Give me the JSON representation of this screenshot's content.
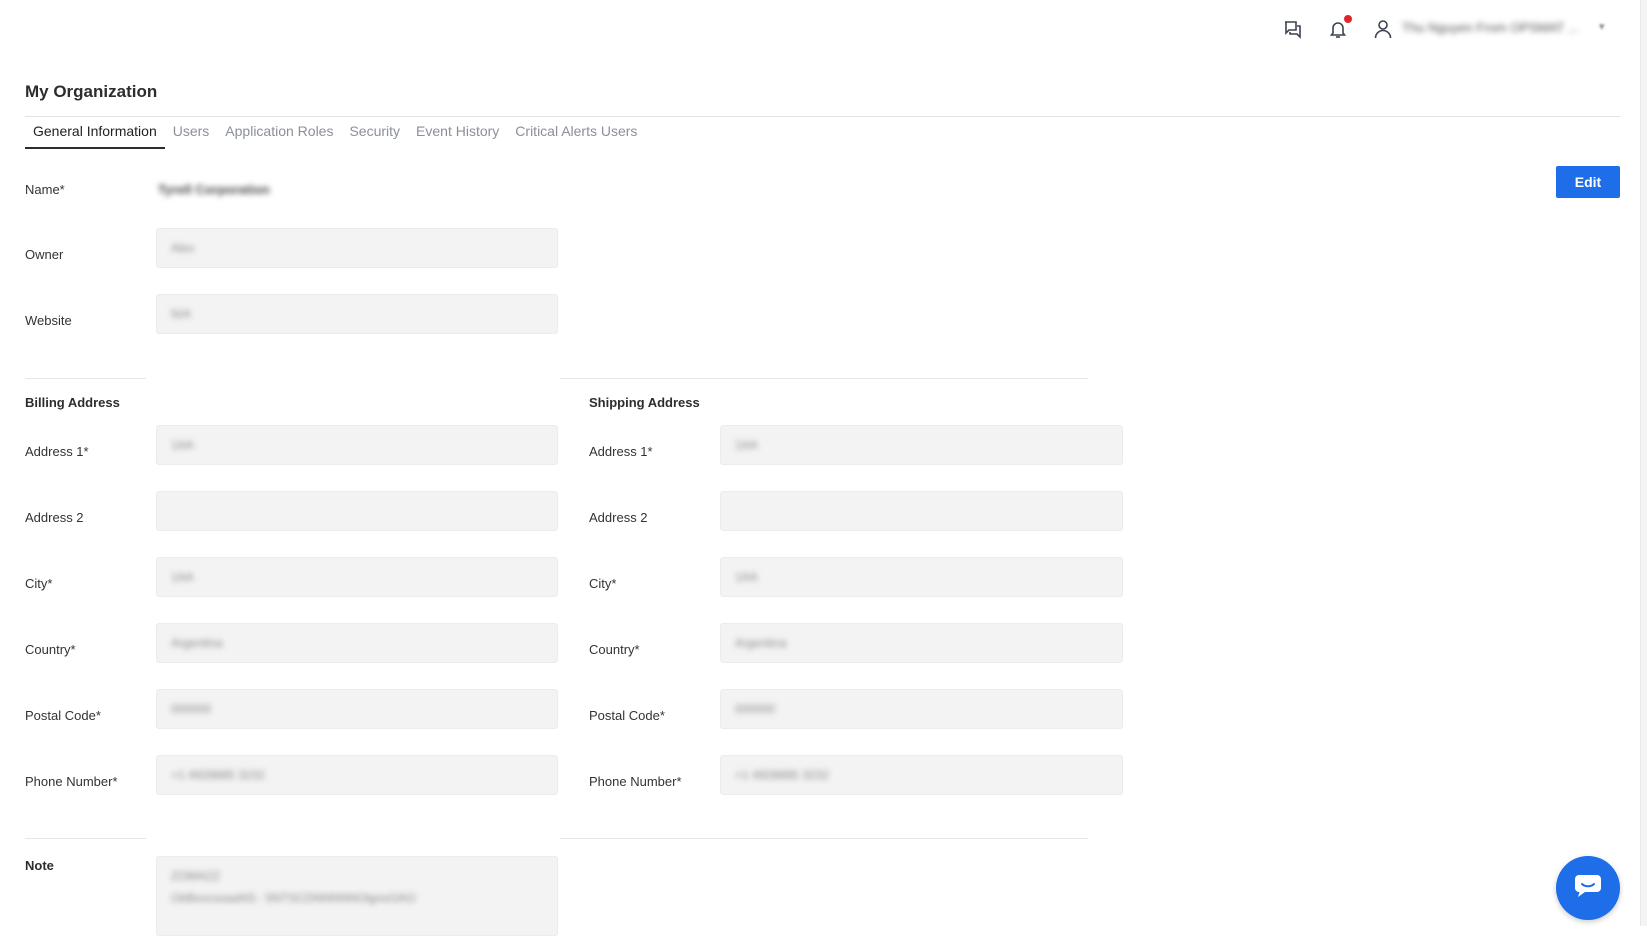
{
  "header": {
    "user_name": "Thu Nguyen From OPSMAT ...",
    "icons": [
      "chat-icon",
      "bell-icon",
      "user-icon",
      "chevron-down-icon"
    ],
    "accent_color": "#1d6ee8",
    "notification_color": "#e0242b"
  },
  "page": {
    "title": "My Organization",
    "edit_label": "Edit"
  },
  "tabs": [
    {
      "label": "General Information",
      "active": true
    },
    {
      "label": "Users",
      "active": false
    },
    {
      "label": "Application Roles",
      "active": false
    },
    {
      "label": "Security",
      "active": false
    },
    {
      "label": "Event History",
      "active": false
    },
    {
      "label": "Critical Alerts Users",
      "active": false
    }
  ],
  "general": {
    "name_label": "Name*",
    "name_value": "Tyrell Corporation",
    "owner_label": "Owner",
    "owner_value": "Alex",
    "website_label": "Website",
    "website_value": "N/A"
  },
  "billing": {
    "title": "Billing Address",
    "address1_label": "Address 1*",
    "address1_value": "1AA",
    "address2_label": "Address 2",
    "address2_value": "",
    "city_label": "City*",
    "city_value": "1AA",
    "country_label": "Country*",
    "country_value": "Argentina",
    "postal_label": "Postal Code*",
    "postal_value": "000000",
    "phone_label": "Phone Number*",
    "phone_value": "+1 4928885 3232"
  },
  "shipping": {
    "title": "Shipping Address",
    "address1_label": "Address 1*",
    "address1_value": "1AA",
    "address2_label": "Address 2",
    "address2_value": "",
    "city_label": "City*",
    "city_value": "1AA",
    "country_label": "Country*",
    "country_value": "Argentina",
    "postal_label": "Postal Code*",
    "postal_value": "000000",
    "phone_label": "Phone Number*",
    "phone_value": "+1 4928885 3232"
  },
  "note": {
    "label": "Note",
    "line1": "ZOMAZZ",
    "line2": "ObBxocssaaNS : 5NTSCDNNNNNOlgnoOAO"
  }
}
